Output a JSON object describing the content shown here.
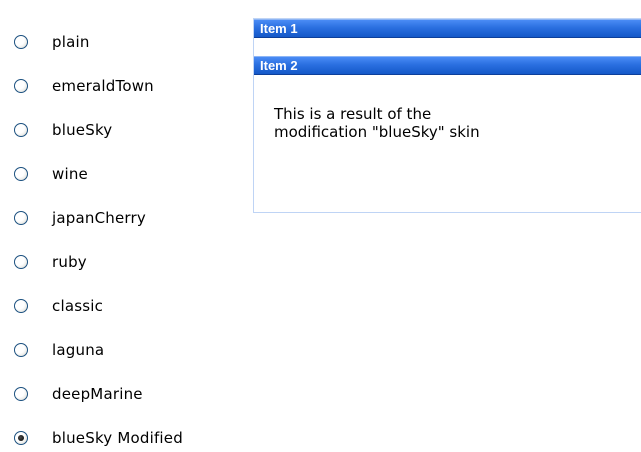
{
  "skins": {
    "options": [
      {
        "label": "plain",
        "checked": false
      },
      {
        "label": "emeraldTown",
        "checked": false
      },
      {
        "label": "blueSky",
        "checked": false
      },
      {
        "label": "wine",
        "checked": false
      },
      {
        "label": "japanCherry",
        "checked": false
      },
      {
        "label": "ruby",
        "checked": false
      },
      {
        "label": "classic",
        "checked": false
      },
      {
        "label": "laguna",
        "checked": false
      },
      {
        "label": "deepMarine",
        "checked": false
      },
      {
        "label": "blueSky Modified",
        "checked": true
      }
    ]
  },
  "panelbar": {
    "items": [
      {
        "header": "Item 1"
      },
      {
        "header": "Item 2",
        "content_line1": "This is a result of the",
        "content_line2": "modification \"blueSky\" skin"
      }
    ]
  },
  "colors": {
    "header_gradient_top": "#4a8cf5",
    "header_gradient_bottom": "#1458c8",
    "panel_border": "#bfd4f5",
    "header_text": "#ffffff"
  },
  "icons": {
    "radio_unchecked": "radio-unchecked-icon",
    "radio_checked": "radio-checked-icon"
  }
}
